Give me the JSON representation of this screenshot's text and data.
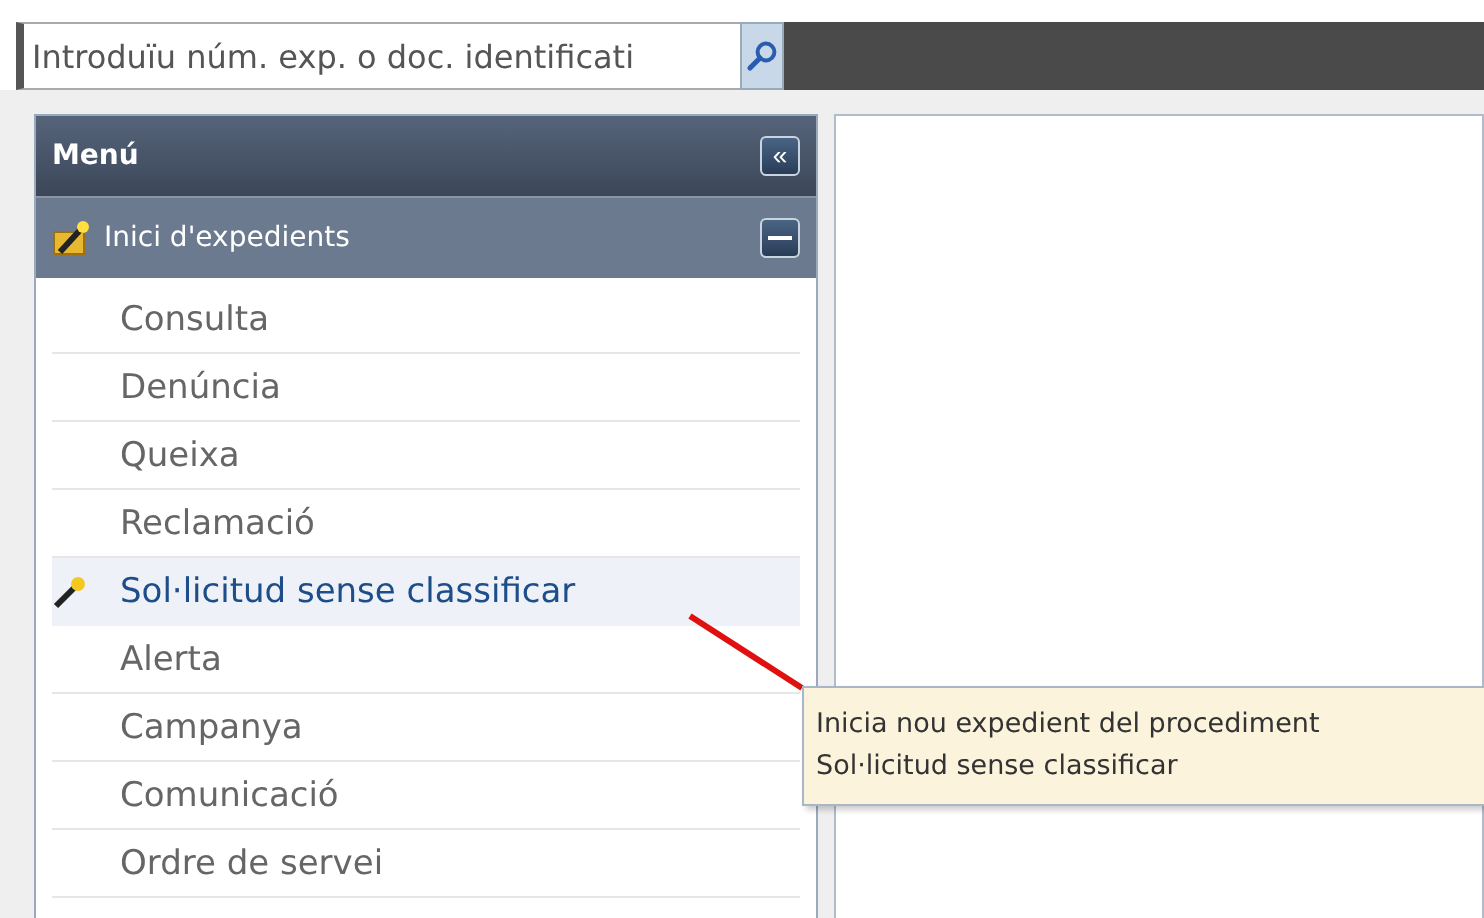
{
  "search": {
    "placeholder": "Introduïu núm. exp. o doc. identificati"
  },
  "menu": {
    "title": "Menú",
    "collapse_icon": "«",
    "section": {
      "label": "Inici d'expedients",
      "expanded": true
    },
    "items": [
      {
        "label": "Consulta",
        "selected": false
      },
      {
        "label": "Denúncia",
        "selected": false
      },
      {
        "label": "Queixa",
        "selected": false
      },
      {
        "label": "Reclamació",
        "selected": false
      },
      {
        "label": "Sol·licitud sense classificar",
        "selected": true
      },
      {
        "label": "Alerta",
        "selected": false
      },
      {
        "label": "Campanya",
        "selected": false
      },
      {
        "label": "Comunicació",
        "selected": false
      },
      {
        "label": "Ordre de servei",
        "selected": false
      }
    ]
  },
  "tooltip": {
    "lines": [
      "Inicia nou expedient del procediment",
      "Sol·licitud sense classificar"
    ]
  }
}
